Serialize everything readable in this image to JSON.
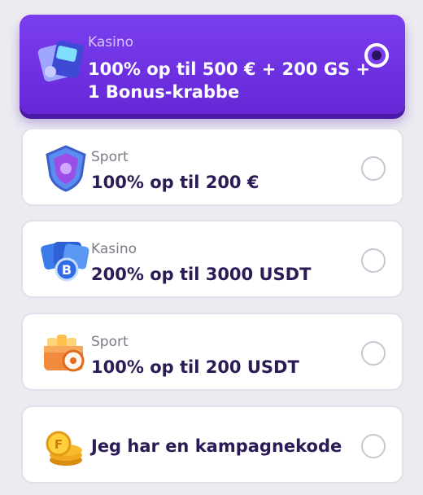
{
  "offers": [
    {
      "category": "Kasino",
      "title_line1": "100% op til 500 € + 200 GS +",
      "title_line2": "1 Bonus-krabbe",
      "icon": "casino-tickets-icon",
      "selected": true
    },
    {
      "category": "Sport",
      "title": "100% op til 200 €",
      "icon": "sport-shield-icon",
      "selected": false
    },
    {
      "category": "Kasino",
      "title": "200% op til 3000 USDT",
      "icon": "bitcoin-cards-icon",
      "selected": false
    },
    {
      "category": "Sport",
      "title": "100% op til 200 USDT",
      "icon": "sport-ball-box-icon",
      "selected": false
    },
    {
      "title": "Jeg har en kampagnekode",
      "icon": "gold-coins-icon",
      "selected": false
    }
  ]
}
